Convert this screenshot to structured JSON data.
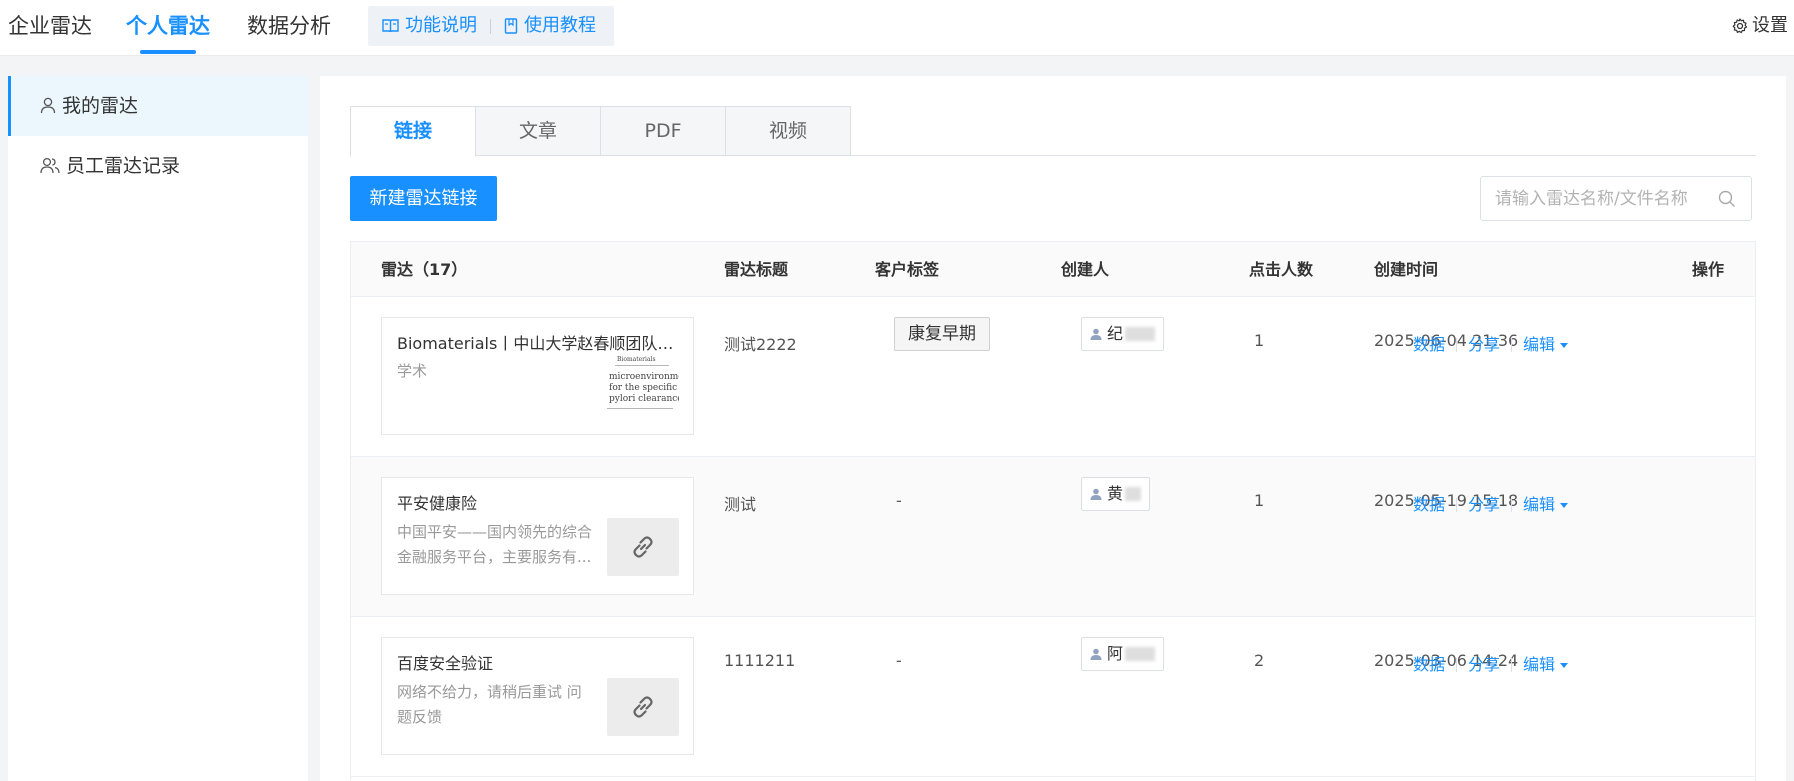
{
  "top_nav": {
    "tabs": [
      {
        "label": "企业雷达",
        "active": false
      },
      {
        "label": "个人雷达",
        "active": true
      },
      {
        "label": "数据分析",
        "active": false
      }
    ],
    "help_links": [
      "功能说明",
      "使用教程"
    ],
    "settings_label": "设置"
  },
  "sidebar": {
    "items": [
      {
        "label": "我的雷达",
        "active": true
      },
      {
        "label": "员工雷达记录",
        "active": false
      }
    ]
  },
  "content_tabs": [
    {
      "label": "链接",
      "active": true
    },
    {
      "label": "文章",
      "active": false
    },
    {
      "label": "PDF",
      "active": false
    },
    {
      "label": "视频",
      "active": false
    }
  ],
  "toolbar": {
    "new_button_label": "新建雷达链接",
    "search_placeholder": "请输入雷达名称/文件名称"
  },
  "table": {
    "columns": [
      "雷达（17）",
      "雷达标题",
      "客户标签",
      "创建人",
      "点击人数",
      "创建时间",
      "操作"
    ],
    "actions": [
      "数据",
      "分享",
      "编辑"
    ],
    "rows": [
      {
        "card_title": "Biomaterials丨中山大学赵春顺团队构...",
        "card_sub": "学术",
        "card_desc": "",
        "thumb": "document",
        "thumb_text": {
          "header": "Biomaterials",
          "line1": "microenvironment resp",
          "line2": "for the specific the",
          "line3": "pylori clearance"
        },
        "radar_title": "测试2222",
        "tag": "康复早期",
        "creator": "纪",
        "clicks": "1",
        "created": "2025-06-04 21:36"
      },
      {
        "card_title": "平安健康险",
        "card_sub": "",
        "card_desc": "中国平安——国内领先的综合金融服务平台，主要服务有...",
        "thumb": "link",
        "radar_title": "测试",
        "tag": "-",
        "creator": "黄",
        "clicks": "1",
        "created": "2025-05-19 15:18"
      },
      {
        "card_title": "百度安全验证",
        "card_sub": "",
        "card_desc": "网络不给力，请稍后重试 问题反馈",
        "thumb": "link",
        "radar_title": "1111211",
        "tag": "-",
        "creator": "阿",
        "clicks": "2",
        "created": "2025-03-06 14:24"
      }
    ]
  }
}
